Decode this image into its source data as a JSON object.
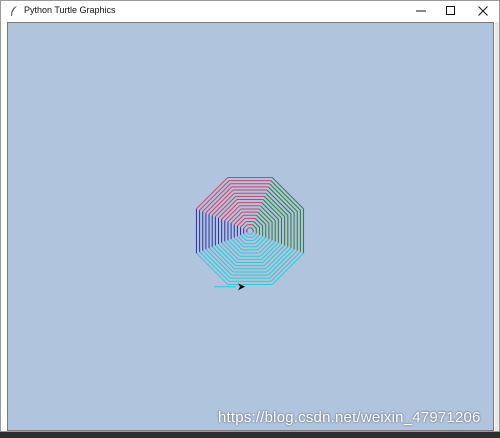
{
  "window": {
    "title": "Python Turtle Graphics",
    "app_icon": "feather-icon",
    "controls": [
      "minimize-icon",
      "maximize-icon",
      "close-icon"
    ]
  },
  "canvas": {
    "background": "#b0c4de",
    "spiral": {
      "shape": "octagon",
      "rings": 17,
      "segment_colors": [
        "#dc143c",
        "#006400",
        "#00ced1",
        "#00008b"
      ]
    },
    "turtle_cursor": "arrow-icon"
  },
  "watermark": "https://blog.csdn.net/weixin_47971206"
}
